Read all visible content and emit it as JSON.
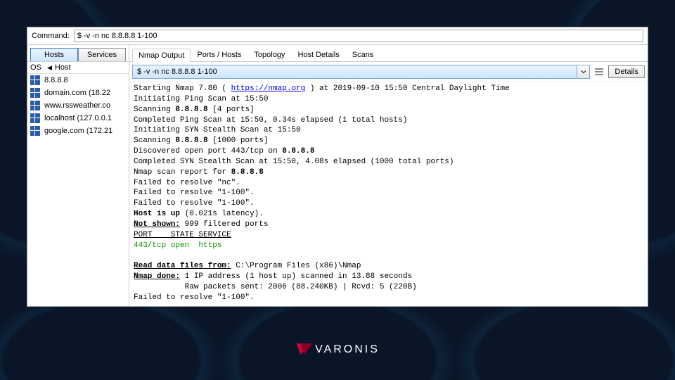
{
  "command": {
    "label": "Command:",
    "value": "$ -v -n nc 8.8.8.8 1-100"
  },
  "sidebar": {
    "tabs": {
      "hosts": "Hosts",
      "services": "Services"
    },
    "header": {
      "os": "OS",
      "host": "Host"
    },
    "items": [
      {
        "label": "8.8.8.8"
      },
      {
        "label": "domain.com (18.22"
      },
      {
        "label": "www.rssweather.co"
      },
      {
        "label": "localhost (127.0.0.1"
      },
      {
        "label": "google.com (172.21"
      }
    ]
  },
  "main": {
    "tabs": {
      "nmap_output": "Nmap Output",
      "ports_hosts": "Ports / Hosts",
      "topology": "Topology",
      "host_details": "Host Details",
      "scans": "Scans"
    },
    "combo_value": "$ -v -n nc 8.8.8.8 1-100",
    "details_label": "Details"
  },
  "output": {
    "l1a": "Starting Nmap 7.80 ( ",
    "l1link": "https://nmap.org",
    "l1b": " ) at 2019-09-10 15:50 Central Daylight Time",
    "l2": "Initiating Ping Scan at 15:50",
    "l3a": "Scanning ",
    "l3b": "8.8.8.8",
    "l3c": " [4 ports]",
    "l4": "Completed Ping Scan at 15:50, 0.34s elapsed (1 total hosts)",
    "l5": "Initiating SYN Stealth Scan at 15:50",
    "l6a": "Scanning ",
    "l6b": "8.8.8.8",
    "l6c": " [1000 ports]",
    "l7a": "Discovered open port 443/tcp on ",
    "l7b": "8.8.8.8",
    "l8": "Completed SYN Stealth Scan at 15:50, 4.08s elapsed (1000 total ports)",
    "l9a": "Nmap scan report for ",
    "l9b": "8.8.8.8",
    "l10": "Failed to resolve \"nc\".",
    "l11": "Failed to resolve \"1-100\".",
    "l12": "Failed to resolve \"1-100\".",
    "l13a": "Host is up",
    "l13b": " (0.021s latency).",
    "l14a": "Not shown:",
    "l14b": " 999 filtered ports",
    "l15": "PORT    STATE SERVICE",
    "l16": "443/tcp open  https",
    "blank": " ",
    "l17a": "Read data files from:",
    "l17b": " C:\\Program Files (x86)\\Nmap",
    "l18a": "Nmap done:",
    "l18b": " 1 IP address (1 host up) scanned in 13.88 seconds",
    "l19": "           Raw packets sent: 2006 (88.240KB) | Rcvd: 5 (220B)",
    "l20": "Failed to resolve \"1-100\"."
  },
  "brand": "VARONIS"
}
